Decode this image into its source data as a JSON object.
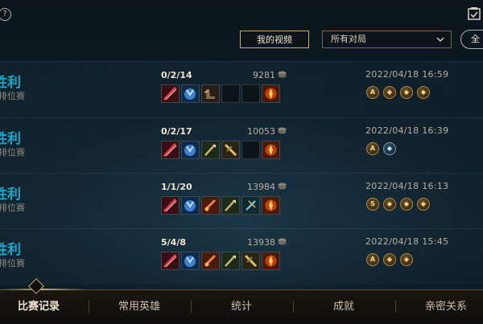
{
  "header": {
    "help_icon": "question-circle-icon",
    "task_icon": "checklist-icon",
    "videos_label": "我的视频",
    "filter_selected": "所有对局",
    "all_label": "全"
  },
  "matches": [
    {
      "result": "胜利",
      "mode": "排位赛",
      "kda": "0/2/14",
      "gold": "9281",
      "date": "2022/04/18 16:59"
    },
    {
      "result": "胜利",
      "mode": "排位赛",
      "kda": "0/2/17",
      "gold": "10053",
      "date": "2022/04/18 16:39"
    },
    {
      "result": "胜利",
      "mode": "排位赛",
      "kda": "1/1/20",
      "gold": "13984",
      "date": "2022/04/18 16:13"
    },
    {
      "result": "胜利",
      "mode": "排位赛",
      "kda": "5/4/8",
      "gold": "13938",
      "date": "2022/04/18 15:45"
    }
  ],
  "badges": [
    [
      "A",
      "◆",
      "◆",
      "◆"
    ],
    [
      "A",
      "◆"
    ],
    [
      "S",
      "◆",
      "◆",
      "◆"
    ],
    [
      "A",
      "◆",
      "◆"
    ]
  ],
  "nav": {
    "items": [
      "比赛记录",
      "常用英雄",
      "统计",
      "成就",
      "亲密关系"
    ],
    "active": "比赛记录"
  },
  "colors": {
    "win": "#16a6c8",
    "gold_accent": "#c8aa6e",
    "text": "#f0e6d2"
  }
}
